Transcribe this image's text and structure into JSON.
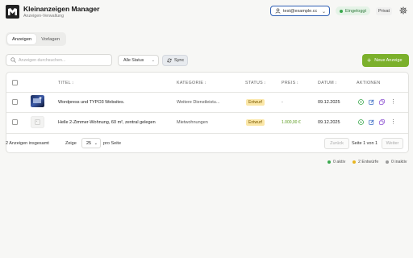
{
  "header": {
    "title": "Kleinanzeigen Manager",
    "subtitle": "Anzeigen-Verwaltung",
    "account_email": "test@example.cc",
    "status_label": "Eingeloggt",
    "mode_label": "Privat",
    "colors": {
      "status_dot": "#3aa84d",
      "account_border": "#2f5fb3"
    }
  },
  "tabs": [
    {
      "label": "Anzeigen",
      "active": true
    },
    {
      "label": "Vorlagen",
      "active": false
    }
  ],
  "toolbar": {
    "search_placeholder": "Anzeigen durchsuchen...",
    "status_filter": "Alle Status",
    "sync_label": "Sync",
    "new_label": "Neue Anzeige",
    "new_color": "#7bb02b"
  },
  "table": {
    "columns": [
      "TITEL",
      "KATEGORIE",
      "STATUS",
      "PREIS",
      "DATUM",
      "AKTIONEN"
    ],
    "rows": [
      {
        "title": "Wordpress und TYPO3 Websites.",
        "category": "Weitere Dienstleistu...",
        "status": "Entwurf",
        "price": "-",
        "date": "09.12.2025",
        "thumbnail": "photo"
      },
      {
        "title": "Helle 2-Zimmer-Wohnung, 60 m², zentral gelegen",
        "category": "Mietwohnungen",
        "status": "Entwurf",
        "price": "1.000,00 €",
        "date": "09.12.2025",
        "thumbnail": "placeholder"
      }
    ]
  },
  "pagination": {
    "total_label": "2 Anzeigen insgesamt",
    "show_label": "Zeige",
    "per_page": "25",
    "per_page_suffix": "pro Seite",
    "prev_label": "Zurück",
    "page_info": "Seite 1 von 1",
    "next_label": "Weiter"
  },
  "stats": [
    {
      "label": "0 aktiv",
      "color": "#3aa84d"
    },
    {
      "label": "2 Entwürfe",
      "color": "#e8b520"
    },
    {
      "label": "0 inaktiv",
      "color": "#9a9a9a"
    }
  ]
}
